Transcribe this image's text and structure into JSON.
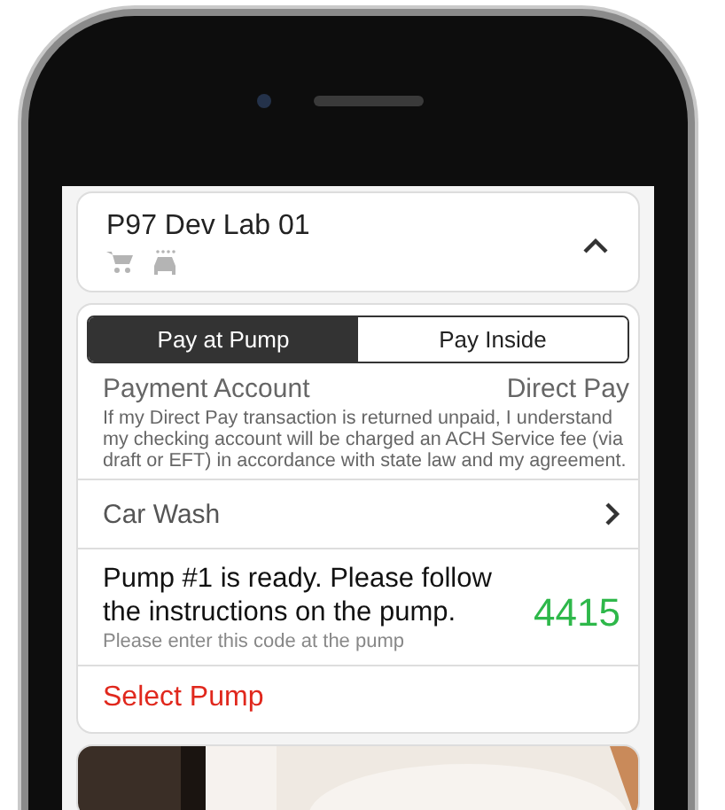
{
  "station": {
    "name": "P97 Dev Lab 01",
    "expanded": true
  },
  "payment_tabs": [
    {
      "label": "Pay at Pump",
      "selected": true
    },
    {
      "label": "Pay Inside",
      "selected": false
    }
  ],
  "payment_account": {
    "label": "Payment Account",
    "value": "Direct Pay",
    "disclaimer": "If my Direct Pay transaction is returned unpaid, I understand my checking account will be charged an ACH Service fee (via draft or EFT) in accordance with state law and my agreement."
  },
  "car_wash": {
    "label": "Car Wash"
  },
  "pump_status": {
    "message": "Pump #1 is ready. Please follow the instructions on the pump.",
    "hint": "Please enter this code at the pump",
    "code": "4415"
  },
  "action": {
    "label": "Select Pump"
  }
}
